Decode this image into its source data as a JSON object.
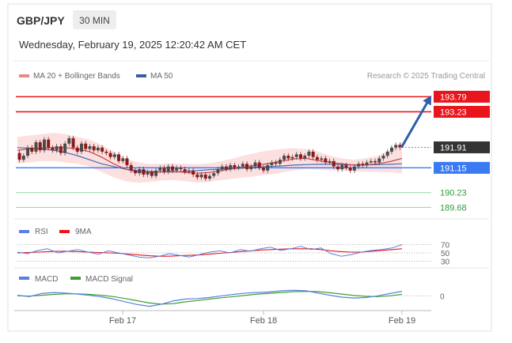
{
  "header": {
    "pair": "GBP/JPY",
    "timeframe": "30 MIN",
    "datetime": "Wednesday, February 19, 2025 12:20:42 AM CET"
  },
  "legend": {
    "ma20": "MA 20 + Bollinger Bands",
    "ma50": "MA 50",
    "credit": "Research © 2025 Trading Central"
  },
  "rsi_legend": {
    "rsi": "RSI",
    "ma9": "9MA"
  },
  "macd_legend": {
    "macd": "MACD",
    "signal": "MACD Signal"
  },
  "colors": {
    "resistance": "#e8151c",
    "support_current": "#3a7bf2",
    "support": "#2f9e3a",
    "candle_up": "#4a4a4a",
    "candle_down": "#8b1a1a",
    "ma20": "#c54444",
    "ma50": "#3d6fb5",
    "band_fill": "#fbd4d4",
    "arrow": "#2f5fa8",
    "rsi": "#5b7fe0",
    "rsi_ma": "#e8151c",
    "macd": "#5b7fe0",
    "macd_signal": "#3ca02f"
  },
  "chart_data": {
    "type": "candlestick",
    "x_ticks": [
      "Feb 17",
      "Feb 18",
      "Feb 19"
    ],
    "ylim": [
      189.4,
      194.3
    ],
    "levels": [
      {
        "value": 193.79,
        "label": "193.79",
        "kind": "resistance"
      },
      {
        "value": 193.23,
        "label": "193.23",
        "kind": "resistance"
      },
      {
        "value": 191.91,
        "label": "191.91",
        "kind": "current"
      },
      {
        "value": 191.15,
        "label": "191.15",
        "kind": "support_current"
      },
      {
        "value": 190.23,
        "label": "190.23",
        "kind": "support"
      },
      {
        "value": 189.68,
        "label": "189.68",
        "kind": "support"
      }
    ],
    "candles": [
      [
        191.7,
        191.45
      ],
      [
        191.45,
        191.6
      ],
      [
        191.6,
        191.9
      ],
      [
        191.9,
        191.75
      ],
      [
        191.75,
        192.1
      ],
      [
        192.1,
        191.8
      ],
      [
        191.8,
        192.2
      ],
      [
        192.2,
        191.9
      ],
      [
        191.9,
        191.8
      ],
      [
        191.8,
        191.95
      ],
      [
        191.95,
        191.7
      ],
      [
        191.7,
        192.05
      ],
      [
        192.05,
        192.25
      ],
      [
        192.25,
        191.9
      ],
      [
        191.9,
        191.75
      ],
      [
        191.75,
        192.05
      ],
      [
        192.05,
        191.85
      ],
      [
        191.85,
        191.95
      ],
      [
        191.95,
        191.8
      ],
      [
        191.8,
        191.9
      ],
      [
        191.9,
        191.75
      ],
      [
        191.75,
        191.7
      ],
      [
        191.7,
        191.55
      ],
      [
        191.55,
        191.65
      ],
      [
        191.65,
        191.4
      ],
      [
        191.4,
        191.5
      ],
      [
        191.5,
        191.25
      ],
      [
        191.25,
        191.05
      ],
      [
        191.05,
        190.95
      ],
      [
        190.95,
        191.1
      ],
      [
        191.1,
        190.9
      ],
      [
        190.9,
        191.0
      ],
      [
        191.0,
        190.85
      ],
      [
        190.85,
        191.05
      ],
      [
        191.05,
        191.15
      ],
      [
        191.15,
        191.0
      ],
      [
        191.0,
        191.2
      ],
      [
        191.2,
        191.05
      ],
      [
        191.05,
        191.15
      ],
      [
        191.15,
        191.1
      ],
      [
        191.1,
        191.0
      ],
      [
        191.0,
        191.05
      ],
      [
        191.05,
        190.9
      ],
      [
        190.9,
        190.8
      ],
      [
        190.8,
        190.9
      ],
      [
        190.9,
        190.75
      ],
      [
        190.75,
        190.85
      ],
      [
        190.85,
        190.95
      ],
      [
        190.95,
        191.1
      ],
      [
        191.1,
        191.2
      ],
      [
        191.2,
        191.1
      ],
      [
        191.1,
        191.25
      ],
      [
        191.25,
        191.15
      ],
      [
        191.15,
        191.2
      ],
      [
        191.2,
        191.3
      ],
      [
        191.3,
        191.1
      ],
      [
        191.1,
        191.2
      ],
      [
        191.2,
        191.35
      ],
      [
        191.35,
        191.15
      ],
      [
        191.15,
        191.05
      ],
      [
        191.05,
        191.25
      ],
      [
        191.25,
        191.35
      ],
      [
        191.35,
        191.3
      ],
      [
        191.3,
        191.45
      ],
      [
        191.45,
        191.6
      ],
      [
        191.6,
        191.5
      ],
      [
        191.5,
        191.55
      ],
      [
        191.55,
        191.65
      ],
      [
        191.65,
        191.5
      ],
      [
        191.5,
        191.6
      ],
      [
        191.6,
        191.75
      ],
      [
        191.75,
        191.55
      ],
      [
        191.55,
        191.45
      ],
      [
        191.45,
        191.5
      ],
      [
        191.5,
        191.35
      ],
      [
        191.35,
        191.4
      ],
      [
        191.4,
        191.2
      ],
      [
        191.2,
        191.1
      ],
      [
        191.1,
        191.25
      ],
      [
        191.25,
        191.15
      ],
      [
        191.15,
        191.05
      ],
      [
        191.05,
        191.2
      ],
      [
        191.2,
        191.3
      ],
      [
        191.3,
        191.25
      ],
      [
        191.25,
        191.35
      ],
      [
        191.35,
        191.4
      ],
      [
        191.4,
        191.35
      ],
      [
        191.35,
        191.5
      ],
      [
        191.5,
        191.6
      ],
      [
        191.6,
        191.75
      ],
      [
        191.75,
        191.9
      ],
      [
        191.9,
        192.0
      ],
      [
        192.0,
        191.91
      ]
    ],
    "ma20": [
      191.8,
      191.85,
      191.88,
      191.9,
      191.9,
      191.85,
      191.75,
      191.55,
      191.3,
      191.1,
      191.0,
      190.98,
      191.0,
      191.02,
      190.98,
      190.95,
      190.98,
      191.05,
      191.12,
      191.2,
      191.25,
      191.32,
      191.4,
      191.48,
      191.5,
      191.42,
      191.35,
      191.3,
      191.25,
      191.25,
      191.3,
      191.38,
      191.5
    ],
    "ma50": [
      191.9,
      191.88,
      191.85,
      191.8,
      191.72,
      191.6,
      191.45,
      191.3,
      191.2,
      191.1,
      191.05,
      191.02,
      191.0,
      191.0,
      191.02,
      191.05,
      191.08,
      191.1,
      191.12,
      191.15,
      191.18,
      191.2,
      191.22,
      191.25,
      191.27,
      191.28,
      191.28,
      191.27,
      191.26,
      191.26,
      191.27,
      191.28,
      191.3
    ],
    "band_upper": [
      192.3,
      192.35,
      192.4,
      192.45,
      192.4,
      192.3,
      192.2,
      192.0,
      191.75,
      191.5,
      191.35,
      191.3,
      191.3,
      191.32,
      191.3,
      191.28,
      191.32,
      191.4,
      191.5,
      191.62,
      191.72,
      191.8,
      191.85,
      191.88,
      191.85,
      191.75,
      191.6,
      191.5,
      191.45,
      191.5,
      191.6,
      191.8,
      192.1
    ],
    "band_lower": [
      191.3,
      191.35,
      191.4,
      191.4,
      191.35,
      191.3,
      191.2,
      191.0,
      190.8,
      190.65,
      190.6,
      190.62,
      190.68,
      190.7,
      190.65,
      190.6,
      190.64,
      190.7,
      190.75,
      190.8,
      190.85,
      190.9,
      190.98,
      191.05,
      191.1,
      191.08,
      191.05,
      191.05,
      191.02,
      191.0,
      191.0,
      190.98,
      190.95
    ],
    "rsi": {
      "ticks": [
        70,
        50,
        30
      ],
      "rsi": [
        52,
        48,
        56,
        60,
        50,
        54,
        58,
        52,
        47,
        55,
        50,
        45,
        40,
        38,
        42,
        48,
        44,
        40,
        46,
        52,
        55,
        50,
        58,
        54,
        60,
        64,
        56,
        60,
        66,
        58,
        62,
        48,
        42,
        46,
        52,
        56,
        58,
        62,
        70
      ],
      "ma9": [
        50,
        51,
        52,
        53,
        54,
        54,
        53,
        52,
        51,
        50,
        49,
        47,
        45,
        43,
        42,
        42,
        43,
        44,
        45,
        47,
        49,
        51,
        53,
        55,
        57,
        58,
        59,
        60,
        60,
        60,
        58,
        55,
        53,
        52,
        52,
        54,
        56,
        58,
        60
      ]
    },
    "macd": {
      "ticks": [
        0
      ],
      "macd": [
        0.02,
        -0.03,
        0.08,
        0.12,
        0.1,
        0.06,
        0.02,
        -0.04,
        -0.12,
        -0.22,
        -0.32,
        -0.38,
        -0.3,
        -0.18,
        -0.12,
        -0.1,
        -0.06,
        0.0,
        0.05,
        0.1,
        0.12,
        0.14,
        0.18,
        0.2,
        0.18,
        0.1,
        0.02,
        -0.05,
        -0.08,
        -0.06,
        0.0,
        0.08,
        0.16
      ],
      "signal": [
        0.0,
        -0.01,
        0.02,
        0.05,
        0.07,
        0.07,
        0.05,
        0.02,
        -0.03,
        -0.1,
        -0.18,
        -0.26,
        -0.3,
        -0.28,
        -0.22,
        -0.17,
        -0.12,
        -0.07,
        -0.03,
        0.02,
        0.06,
        0.09,
        0.12,
        0.15,
        0.16,
        0.15,
        0.11,
        0.06,
        0.01,
        -0.02,
        -0.03,
        0.0,
        0.05
      ]
    }
  }
}
